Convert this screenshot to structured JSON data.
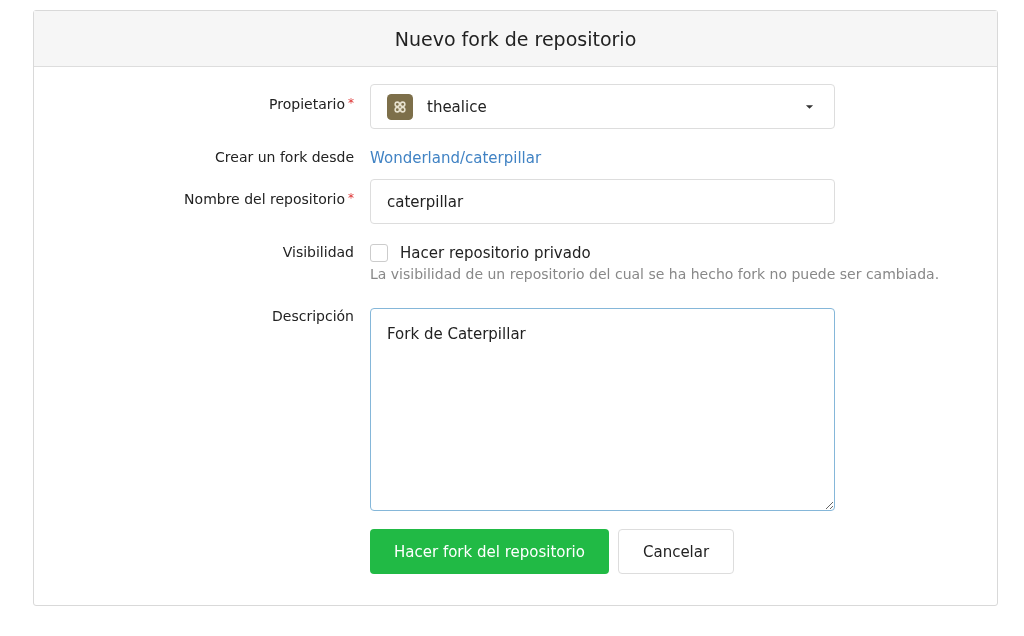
{
  "title": "Nuevo fork de repositorio",
  "owner": {
    "label": "Propietario",
    "required_mark": "*",
    "value": "thealice"
  },
  "fork_from": {
    "label": "Crear un fork desde",
    "link": "Wonderland/caterpillar"
  },
  "repo_name": {
    "label": "Nombre del repositorio",
    "required_mark": "*",
    "value": "caterpillar"
  },
  "visibility": {
    "label": "Visibilidad",
    "checkbox_label": "Hacer repositorio privado",
    "checked": false,
    "help": "La visibilidad de un repositorio del cual se ha hecho fork no puede ser cambiada."
  },
  "description": {
    "label": "Descripción",
    "value": "Fork de Caterpillar",
    "focused": true
  },
  "buttons": [
    {
      "label": "Hacer fork del repositorio",
      "kind": "primary"
    },
    {
      "label": "Cancelar",
      "kind": "secondary"
    }
  ]
}
